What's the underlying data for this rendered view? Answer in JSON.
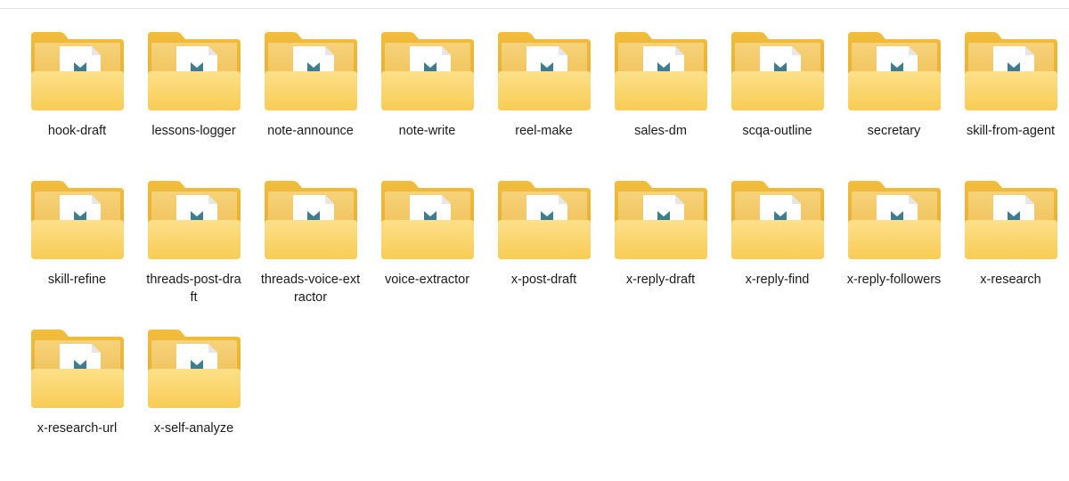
{
  "folders": [
    {
      "name": "hook-draft"
    },
    {
      "name": "lessons-logger"
    },
    {
      "name": "note-announce"
    },
    {
      "name": "note-write"
    },
    {
      "name": "reel-make"
    },
    {
      "name": "sales-dm"
    },
    {
      "name": "scqa-outline"
    },
    {
      "name": "secretary"
    },
    {
      "name": "skill-from-agent"
    },
    {
      "name": "skill-refine"
    },
    {
      "name": "threads-post-dra\nft"
    },
    {
      "name": "threads-voice-ext\nractor"
    },
    {
      "name": "voice-extractor"
    },
    {
      "name": "x-post-draft"
    },
    {
      "name": "x-reply-draft"
    },
    {
      "name": "x-reply-find"
    },
    {
      "name": "x-reply-followers"
    },
    {
      "name": "x-research"
    },
    {
      "name": "x-research-url"
    },
    {
      "name": "x-self-analyze"
    }
  ],
  "icon": "folder-icon",
  "colors": {
    "folder_back": "#e9b83f",
    "folder_front": "#f9d46e",
    "doc_mark": "#3d7d8f"
  }
}
